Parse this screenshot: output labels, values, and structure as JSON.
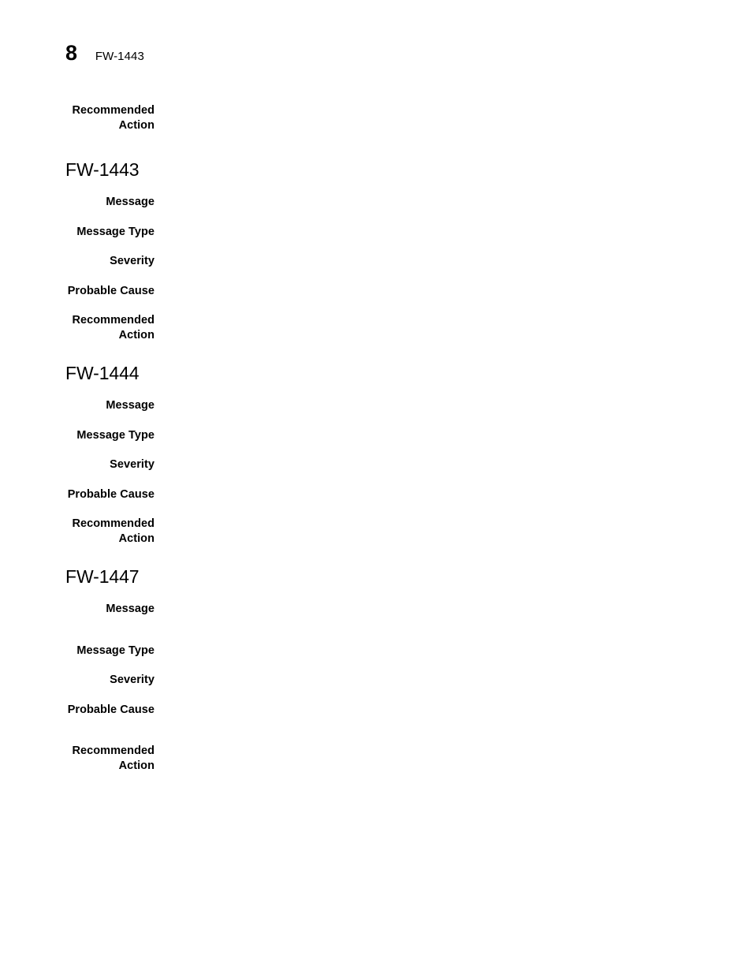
{
  "header": {
    "page_number": "8",
    "title": "FW-1443"
  },
  "orphan_field": {
    "label": "Recommended\nAction",
    "value": ""
  },
  "sections": [
    {
      "heading": "FW-1443",
      "fields": [
        {
          "label": "Message",
          "value": ""
        },
        {
          "label": "Message Type",
          "value": ""
        },
        {
          "label": "Severity",
          "value": ""
        },
        {
          "label": "Probable Cause",
          "value": ""
        },
        {
          "label": "Recommended\nAction",
          "value": ""
        }
      ]
    },
    {
      "heading": "FW-1444",
      "fields": [
        {
          "label": "Message",
          "value": ""
        },
        {
          "label": "Message Type",
          "value": ""
        },
        {
          "label": "Severity",
          "value": ""
        },
        {
          "label": "Probable Cause",
          "value": ""
        },
        {
          "label": "Recommended\nAction",
          "value": ""
        }
      ]
    },
    {
      "heading": "FW-1447",
      "fields": [
        {
          "label": "Message",
          "value": ""
        },
        {
          "label": "Message Type",
          "value": ""
        },
        {
          "label": "Severity",
          "value": ""
        },
        {
          "label": "Probable Cause",
          "value": ""
        },
        {
          "label": "Recommended\nAction",
          "value": ""
        }
      ]
    }
  ]
}
